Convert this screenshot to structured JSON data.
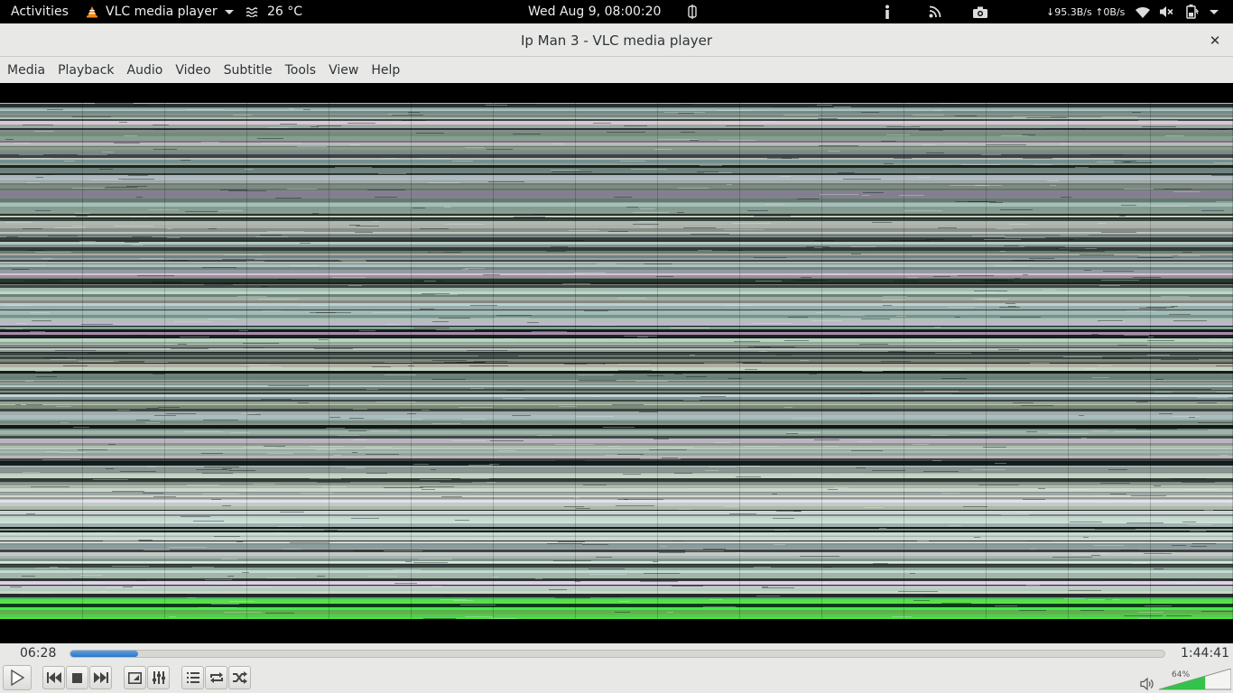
{
  "topbar": {
    "activities": "Activities",
    "app_name": "VLC media player",
    "weather": "26 °C",
    "clock": "Wed Aug  9, 08:00:20",
    "network_speed": "↓95.3B/s ↑0B/s",
    "icons": [
      "vlc-cone-icon",
      "weather-icon",
      "keyboard-icon",
      "info-icon",
      "rss-icon",
      "camera-icon",
      "wifi-icon",
      "volume-muted-icon",
      "battery-icon",
      "system-menu-icon"
    ]
  },
  "window": {
    "title": "Ip Man 3 - VLC media player",
    "close_label": "✕"
  },
  "menubar": {
    "items": [
      "Media",
      "Playback",
      "Audio",
      "Video",
      "Subtitle",
      "Tools",
      "View",
      "Help"
    ]
  },
  "player": {
    "elapsed": "06:28",
    "total": "1:44:41",
    "progress_fraction": 0.062,
    "volume_label": "64%",
    "volume_fraction": 0.64,
    "controls": [
      "play",
      "previous",
      "stop",
      "next",
      "fullscreen",
      "extended-settings",
      "playlist",
      "loop",
      "random"
    ]
  },
  "colors": {
    "accent": "#3584e4",
    "volume_fill": "#33c24a",
    "topbar_bg": "#000000",
    "window_bg": "#e8e8e7"
  }
}
